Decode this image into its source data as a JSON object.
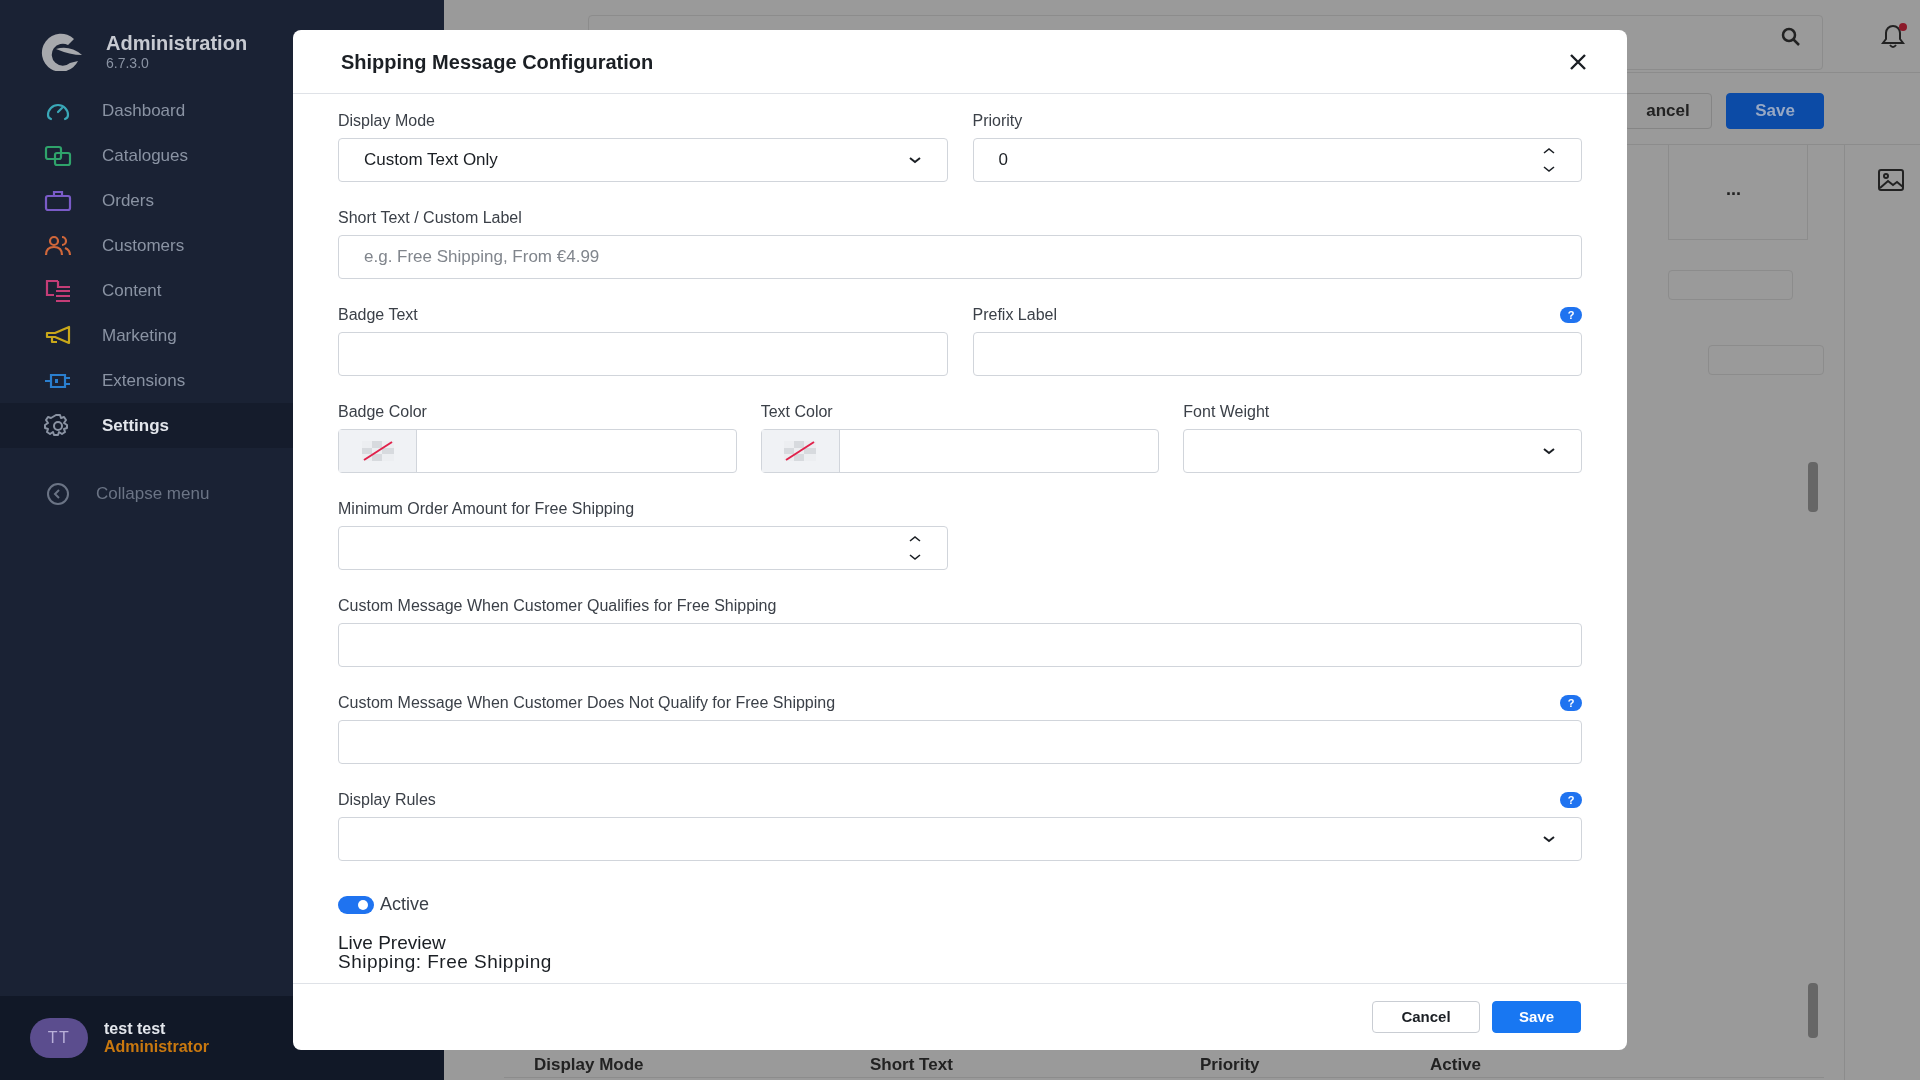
{
  "sidebar": {
    "title": "Administration",
    "version": "6.7.3.0",
    "items": [
      {
        "label": "Dashboard",
        "selected": false
      },
      {
        "label": "Catalogues",
        "selected": false
      },
      {
        "label": "Orders",
        "selected": false
      },
      {
        "label": "Customers",
        "selected": false
      },
      {
        "label": "Content",
        "selected": false
      },
      {
        "label": "Marketing",
        "selected": false
      },
      {
        "label": "Extensions",
        "selected": false
      },
      {
        "label": "Settings",
        "selected": true
      }
    ],
    "collapse": "Collapse menu",
    "user": {
      "initials": "TT",
      "name": "test test",
      "role": "Administrator"
    }
  },
  "background": {
    "buttons": [
      {
        "label": "ancel",
        "kind": "secondary"
      },
      {
        "label": "Save",
        "kind": "primary"
      }
    ],
    "cell_text": "...",
    "table_columns": [
      "Display Mode",
      "Short Text",
      "Priority",
      "Active"
    ]
  },
  "modal": {
    "title": "Shipping Message Configuration",
    "rows": [
      {
        "fields": [
          {
            "label": "Display Mode",
            "kind": "select",
            "value": "Custom Text Only"
          },
          {
            "label": "Priority",
            "kind": "number",
            "value": "0"
          }
        ]
      },
      {
        "fields": [
          {
            "label": "Short Text / Custom Label",
            "kind": "text",
            "placeholder": "e.g. Free Shipping, From €4.99"
          }
        ]
      },
      {
        "fields": [
          {
            "label": "Badge Text",
            "kind": "text"
          },
          {
            "label": "Prefix Label",
            "kind": "text",
            "help": "?"
          }
        ]
      },
      {
        "fields": [
          {
            "label": "Badge Color",
            "kind": "color"
          },
          {
            "label": "Text Color",
            "kind": "color"
          },
          {
            "label": "Font Weight",
            "kind": "select"
          }
        ]
      },
      {
        "fields": [
          {
            "label": "Minimum Order Amount for Free Shipping",
            "kind": "number"
          }
        ]
      },
      {
        "fields": [
          {
            "label": "Custom Message When Customer Qualifies for Free Shipping",
            "kind": "text"
          }
        ]
      },
      {
        "fields": [
          {
            "label": "Custom Message When Customer Does Not Qualify for Free Shipping",
            "kind": "text",
            "help": "?"
          }
        ]
      },
      {
        "fields": [
          {
            "label": "Display Rules",
            "kind": "select",
            "help": "?"
          }
        ]
      }
    ],
    "toggle": {
      "label": "Active",
      "on": true
    },
    "preview": {
      "title": "Live Preview",
      "text": "Shipping: Free Shipping"
    },
    "buttons": [
      {
        "label": "Cancel",
        "kind": "secondary"
      },
      {
        "label": "Save",
        "kind": "primary"
      }
    ]
  }
}
